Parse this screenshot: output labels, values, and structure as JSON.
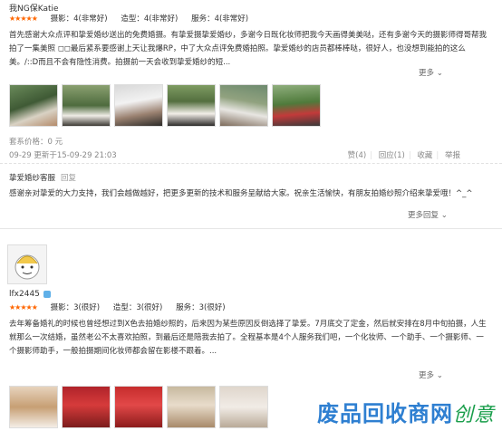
{
  "review1": {
    "user": "我NG保Katie",
    "stars": "★★★★★",
    "ratings": [
      "摄影：4(非常好)",
      "造型：4(非常好)",
      "服务：4(非常好)"
    ],
    "text": "首先感谢大众点评和挚爱婚纱送出的免费婚摄。有挚爱摄挚爱婚纱，多谢今日既化妆师把我今天画得美美哒，还有多谢今天的摄影师得哥帮我拍了一集美照 ◻◻最后紧系要感谢上天让我爆RP，中了大众点评免费婚拍照。挚爱婚纱的店员都棒棒哒，很好人，也没想到能拍的这么美。/::D而且不会有隐性消费。拍摄前一天会收到挚爱婚纱的短...",
    "more": "更多",
    "price": "套系价格：0 元",
    "date": "09-29  更新于15-09-29 21:03",
    "actions": [
      "赞(4)",
      "回应(1)",
      "收藏",
      "举报"
    ],
    "reply": {
      "author": "挚爱婚纱客服",
      "reply_link": "回复",
      "text": "感谢亲对挚爱的大力支持，我们会越做越好，把更多更新的技术和服务呈献给大家。祝亲生活愉快，有朋友拍婚纱照介绍来挚爱哦！^_^",
      "more": "更多回复"
    }
  },
  "review2": {
    "user": "lfx2445",
    "stars": "★★★★★",
    "ratings": [
      "摄影：3(很好)",
      "造型：3(很好)",
      "服务：3(很好)"
    ],
    "text": "去年筹备婚礼的时候也曾经想过到X色去拍婚纱照的，后来因为某些原因反倒选择了挚爱。7月底交了定金，然后就安排在8月中旬拍摄，人生就那么一次结婚，虽然老公不太喜欢拍照，到最后还是陪我去拍了。全程基本是4个人服务我们吧，一个化妆师、一个助手、一个摄影师、一个摄影师助手，一般拍摄期间化妆师都会留在影楼不跟着。...",
    "more": "更多"
  },
  "watermark": {
    "main": "废品回收商网",
    "sub": "创意"
  }
}
